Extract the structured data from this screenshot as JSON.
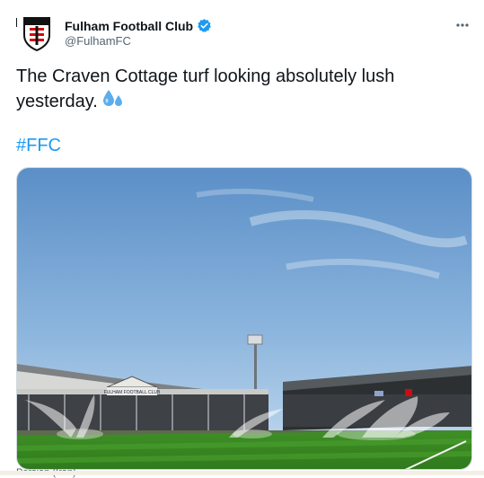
{
  "tweet": {
    "display_name": "Fulham Football Club",
    "handle": "@FulhamFC",
    "verified": true,
    "text": "The Craven Cottage turf looking absolutely lush yesterday.",
    "emoji": "sweat-droplets-emoji",
    "hashtag": "#FFC",
    "more_icon": "more-options-icon",
    "media": {
      "stand_sign": "FULHAM FOOTBALL CLUB"
    }
  },
  "cutoff_text": "Persian (Iran)",
  "colors": {
    "accent": "#1d9bf0",
    "text": "#0f1419",
    "secondary": "#536471",
    "sky_top": "#5b8fc7",
    "pitch": "#3c8a24"
  }
}
